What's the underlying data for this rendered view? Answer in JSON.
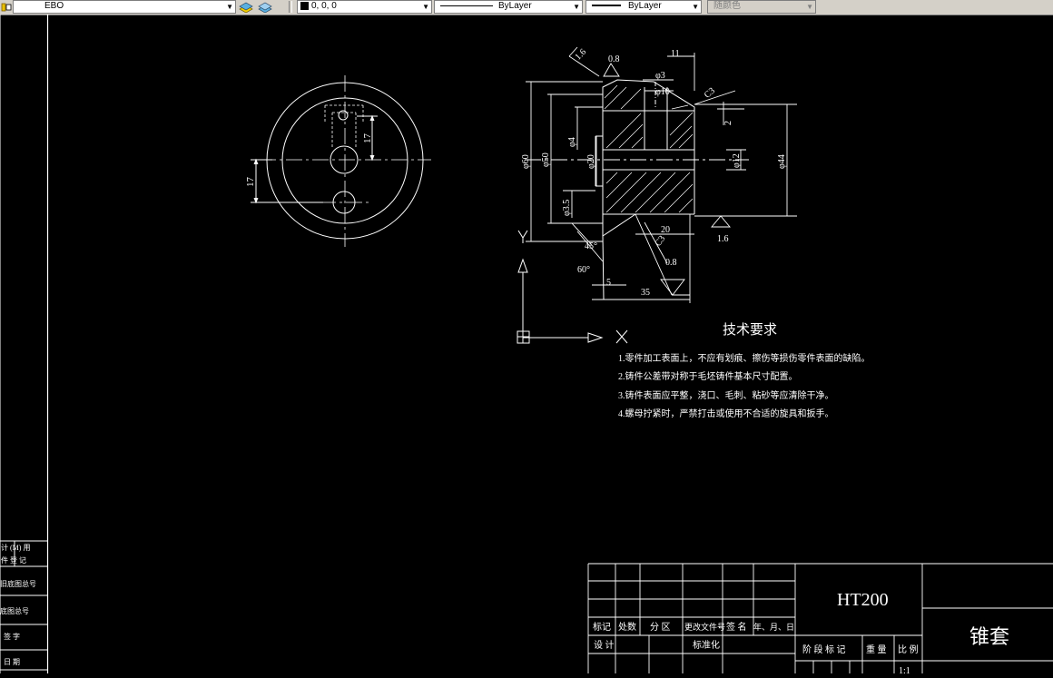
{
  "toolbar": {
    "layer_name": "EBO",
    "color_value": "0, 0, 0",
    "linetype": "ByLayer",
    "lineweight": "ByLayer",
    "plotstyle": "随颜色",
    "icons": [
      "layer-state-icon",
      "layer-previous-icon",
      "layers-icon"
    ]
  },
  "side_block": {
    "rows": [
      "计 (M) 用",
      "件 登 记",
      "旧底图总号",
      "底图总号",
      "签 字",
      "日 期"
    ]
  },
  "dimensions": {
    "top_view": {
      "d17a": "17",
      "d17b": "17"
    },
    "section": {
      "r16": "1.6",
      "r08a": "0.8",
      "d11": "11",
      "phi3": "φ3",
      "phi10": "φ10",
      "c3a": "C3",
      "d2": "2",
      "phi60": "φ60",
      "phi50": "φ50",
      "phi4": "φ4",
      "phi20": "φ20",
      "phi12": "φ12",
      "phi44": "φ44",
      "phi35": "φ3.5",
      "d20": "20",
      "c3b": "C3",
      "r16b": "1.6",
      "a45": "45°",
      "a60": "60°",
      "r08b": "0.8",
      "d5": "5",
      "d35": "35"
    }
  },
  "ucs": {
    "y_label": "Y",
    "x_label": "X"
  },
  "notes": {
    "title": "技术要求",
    "items": [
      "1.零件加工表面上，不应有划痕、擦伤等损伤零件表面的缺陷。",
      "2.铸件公差带对称于毛坯铸件基本尺寸配置。",
      "3.铸件表面应平整，浇口、毛刺、粘砂等应清除干净。",
      "4.螺母拧紧时，严禁打击或使用不合适的旋具和扳手。"
    ]
  },
  "title_block": {
    "material": "HT200",
    "part_name": "锥套",
    "row_headers": [
      "标记",
      "处数",
      "分 区",
      "更改文件号",
      "签 名",
      "年、月、日"
    ],
    "design_label": "设 计",
    "standard_label": "标准化",
    "stage_label": "阶 段 标 记",
    "weight_label": "重 量",
    "scale_label": "比 例",
    "scale_value": "1:1"
  }
}
